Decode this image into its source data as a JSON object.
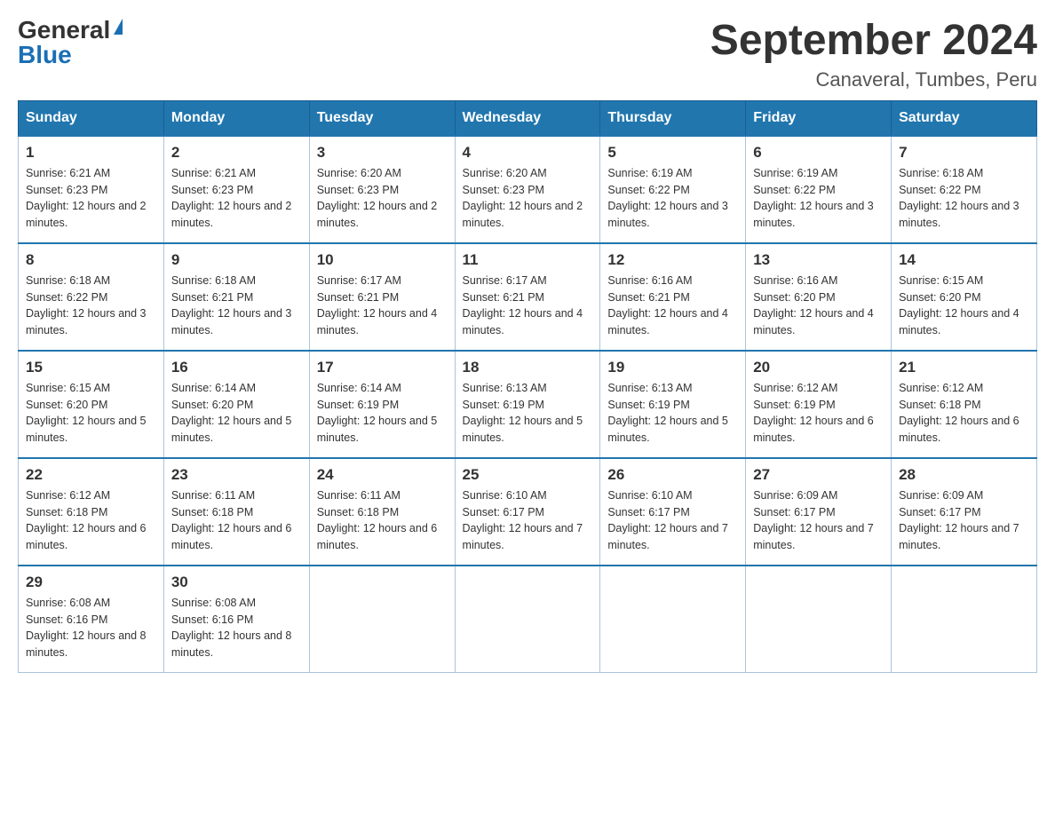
{
  "logo": {
    "general": "General",
    "blue": "Blue",
    "triangle": true
  },
  "title": "September 2024",
  "location": "Canaveral, Tumbes, Peru",
  "weekdays": [
    "Sunday",
    "Monday",
    "Tuesday",
    "Wednesday",
    "Thursday",
    "Friday",
    "Saturday"
  ],
  "weeks": [
    [
      {
        "day": "1",
        "sunrise": "Sunrise: 6:21 AM",
        "sunset": "Sunset: 6:23 PM",
        "daylight": "Daylight: 12 hours and 2 minutes."
      },
      {
        "day": "2",
        "sunrise": "Sunrise: 6:21 AM",
        "sunset": "Sunset: 6:23 PM",
        "daylight": "Daylight: 12 hours and 2 minutes."
      },
      {
        "day": "3",
        "sunrise": "Sunrise: 6:20 AM",
        "sunset": "Sunset: 6:23 PM",
        "daylight": "Daylight: 12 hours and 2 minutes."
      },
      {
        "day": "4",
        "sunrise": "Sunrise: 6:20 AM",
        "sunset": "Sunset: 6:23 PM",
        "daylight": "Daylight: 12 hours and 2 minutes."
      },
      {
        "day": "5",
        "sunrise": "Sunrise: 6:19 AM",
        "sunset": "Sunset: 6:22 PM",
        "daylight": "Daylight: 12 hours and 3 minutes."
      },
      {
        "day": "6",
        "sunrise": "Sunrise: 6:19 AM",
        "sunset": "Sunset: 6:22 PM",
        "daylight": "Daylight: 12 hours and 3 minutes."
      },
      {
        "day": "7",
        "sunrise": "Sunrise: 6:18 AM",
        "sunset": "Sunset: 6:22 PM",
        "daylight": "Daylight: 12 hours and 3 minutes."
      }
    ],
    [
      {
        "day": "8",
        "sunrise": "Sunrise: 6:18 AM",
        "sunset": "Sunset: 6:22 PM",
        "daylight": "Daylight: 12 hours and 3 minutes."
      },
      {
        "day": "9",
        "sunrise": "Sunrise: 6:18 AM",
        "sunset": "Sunset: 6:21 PM",
        "daylight": "Daylight: 12 hours and 3 minutes."
      },
      {
        "day": "10",
        "sunrise": "Sunrise: 6:17 AM",
        "sunset": "Sunset: 6:21 PM",
        "daylight": "Daylight: 12 hours and 4 minutes."
      },
      {
        "day": "11",
        "sunrise": "Sunrise: 6:17 AM",
        "sunset": "Sunset: 6:21 PM",
        "daylight": "Daylight: 12 hours and 4 minutes."
      },
      {
        "day": "12",
        "sunrise": "Sunrise: 6:16 AM",
        "sunset": "Sunset: 6:21 PM",
        "daylight": "Daylight: 12 hours and 4 minutes."
      },
      {
        "day": "13",
        "sunrise": "Sunrise: 6:16 AM",
        "sunset": "Sunset: 6:20 PM",
        "daylight": "Daylight: 12 hours and 4 minutes."
      },
      {
        "day": "14",
        "sunrise": "Sunrise: 6:15 AM",
        "sunset": "Sunset: 6:20 PM",
        "daylight": "Daylight: 12 hours and 4 minutes."
      }
    ],
    [
      {
        "day": "15",
        "sunrise": "Sunrise: 6:15 AM",
        "sunset": "Sunset: 6:20 PM",
        "daylight": "Daylight: 12 hours and 5 minutes."
      },
      {
        "day": "16",
        "sunrise": "Sunrise: 6:14 AM",
        "sunset": "Sunset: 6:20 PM",
        "daylight": "Daylight: 12 hours and 5 minutes."
      },
      {
        "day": "17",
        "sunrise": "Sunrise: 6:14 AM",
        "sunset": "Sunset: 6:19 PM",
        "daylight": "Daylight: 12 hours and 5 minutes."
      },
      {
        "day": "18",
        "sunrise": "Sunrise: 6:13 AM",
        "sunset": "Sunset: 6:19 PM",
        "daylight": "Daylight: 12 hours and 5 minutes."
      },
      {
        "day": "19",
        "sunrise": "Sunrise: 6:13 AM",
        "sunset": "Sunset: 6:19 PM",
        "daylight": "Daylight: 12 hours and 5 minutes."
      },
      {
        "day": "20",
        "sunrise": "Sunrise: 6:12 AM",
        "sunset": "Sunset: 6:19 PM",
        "daylight": "Daylight: 12 hours and 6 minutes."
      },
      {
        "day": "21",
        "sunrise": "Sunrise: 6:12 AM",
        "sunset": "Sunset: 6:18 PM",
        "daylight": "Daylight: 12 hours and 6 minutes."
      }
    ],
    [
      {
        "day": "22",
        "sunrise": "Sunrise: 6:12 AM",
        "sunset": "Sunset: 6:18 PM",
        "daylight": "Daylight: 12 hours and 6 minutes."
      },
      {
        "day": "23",
        "sunrise": "Sunrise: 6:11 AM",
        "sunset": "Sunset: 6:18 PM",
        "daylight": "Daylight: 12 hours and 6 minutes."
      },
      {
        "day": "24",
        "sunrise": "Sunrise: 6:11 AM",
        "sunset": "Sunset: 6:18 PM",
        "daylight": "Daylight: 12 hours and 6 minutes."
      },
      {
        "day": "25",
        "sunrise": "Sunrise: 6:10 AM",
        "sunset": "Sunset: 6:17 PM",
        "daylight": "Daylight: 12 hours and 7 minutes."
      },
      {
        "day": "26",
        "sunrise": "Sunrise: 6:10 AM",
        "sunset": "Sunset: 6:17 PM",
        "daylight": "Daylight: 12 hours and 7 minutes."
      },
      {
        "day": "27",
        "sunrise": "Sunrise: 6:09 AM",
        "sunset": "Sunset: 6:17 PM",
        "daylight": "Daylight: 12 hours and 7 minutes."
      },
      {
        "day": "28",
        "sunrise": "Sunrise: 6:09 AM",
        "sunset": "Sunset: 6:17 PM",
        "daylight": "Daylight: 12 hours and 7 minutes."
      }
    ],
    [
      {
        "day": "29",
        "sunrise": "Sunrise: 6:08 AM",
        "sunset": "Sunset: 6:16 PM",
        "daylight": "Daylight: 12 hours and 8 minutes."
      },
      {
        "day": "30",
        "sunrise": "Sunrise: 6:08 AM",
        "sunset": "Sunset: 6:16 PM",
        "daylight": "Daylight: 12 hours and 8 minutes."
      },
      null,
      null,
      null,
      null,
      null
    ]
  ]
}
